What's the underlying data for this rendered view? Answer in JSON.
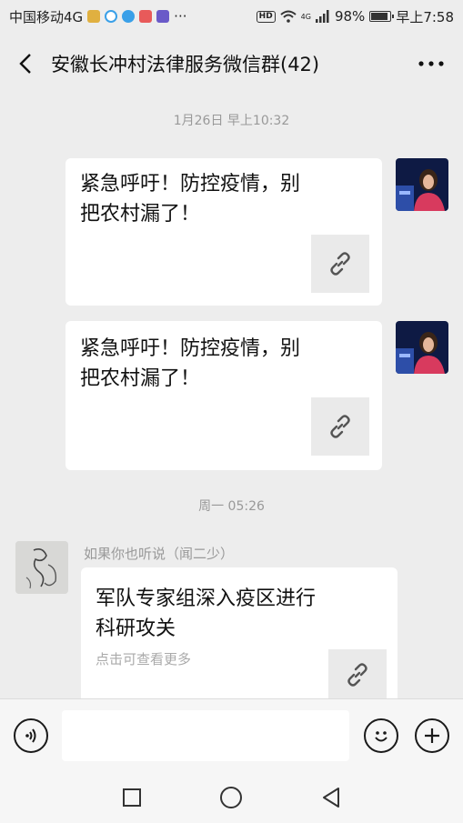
{
  "status_bar": {
    "carrier": "中国移动4G",
    "more": "···",
    "hd": "HD",
    "network": "4G",
    "battery": "98%",
    "time": "早上7:58"
  },
  "header": {
    "title": "安徽长冲村法律服务微信群(42)",
    "back_icon": "chevron-left-icon",
    "more_icon": "more-dots-icon"
  },
  "messages": {
    "time_1": "1月26日 早上10:32",
    "msg_1": {
      "title_line1": "紧急呼吁！防控疫情，别",
      "title_line2": "把农村漏了！"
    },
    "msg_2": {
      "title_line1": "紧急呼吁！防控疫情，别",
      "title_line2": "把农村漏了！"
    },
    "time_2": "周一 05:26",
    "msg_3": {
      "sender": "如果你也听说（闻二少）",
      "title_line1": "军队专家组深入疫区进行",
      "title_line2": "科研攻关",
      "desc": "点击可查看更多"
    }
  },
  "input_bar": {
    "voice_icon": "voice-icon",
    "emoji_icon": "emoji-icon",
    "plus_icon": "plus-icon",
    "input_value": ""
  },
  "nav_bar": {
    "recents_icon": "square-icon",
    "home_icon": "circle-icon",
    "back_icon": "triangle-back-icon"
  }
}
